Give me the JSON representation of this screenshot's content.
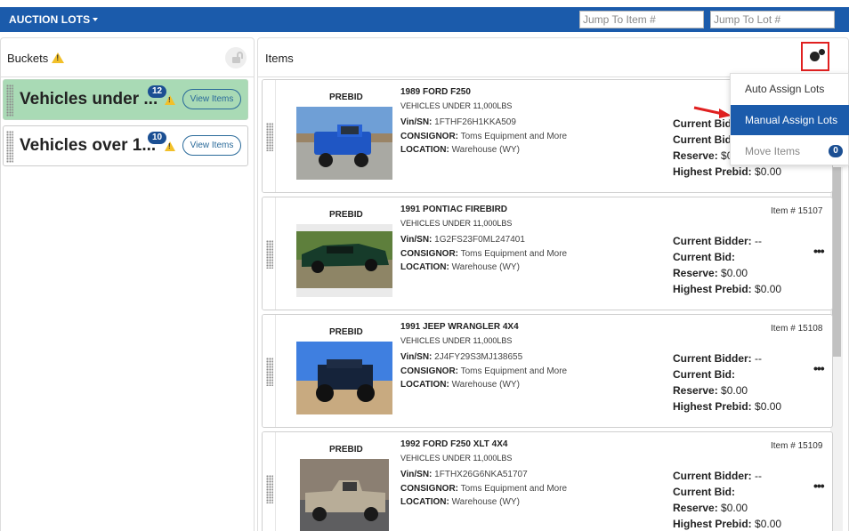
{
  "topbar": {
    "title": "AUCTION LOTS",
    "jump_item_placeholder": "Jump To Item #",
    "jump_lot_placeholder": "Jump To Lot #"
  },
  "buckets": {
    "title": "Buckets",
    "items": [
      {
        "name": "Vehicles under ...",
        "count": "12",
        "button": "View Items",
        "active": true
      },
      {
        "name": "Vehicles over 1...",
        "count": "10",
        "button": "View Items",
        "active": false
      }
    ]
  },
  "items_panel": {
    "title": "Items",
    "items": [
      {
        "tag": "PREBID",
        "title": "1989 FORD F250",
        "category": "VEHICLES UNDER 11,000LBS",
        "vin_label": "Vin/SN:",
        "vin": "1FTHF26H1KKA509",
        "consignor_label": "CONSIGNOR:",
        "consignor": "Toms Equipment and More",
        "location_label": "LOCATION:",
        "location": "Warehouse (WY)",
        "item_no": "",
        "current_bidder_label": "Current Bid",
        "current_bidder": "",
        "current_bid_label": "Current Bid",
        "current_bid": "",
        "reserve_label": "Reserve:",
        "reserve": "$0.",
        "highest_prebid_label": "Highest Prebid:",
        "highest_prebid": "$0.00"
      },
      {
        "tag": "PREBID",
        "title": "1991 PONTIAC FIREBIRD",
        "category": "VEHICLES UNDER 11,000LBS",
        "vin_label": "Vin/SN:",
        "vin": "1G2FS23F0ML247401",
        "consignor_label": "CONSIGNOR:",
        "consignor": "Toms Equipment and More",
        "location_label": "LOCATION:",
        "location": "Warehouse (WY)",
        "item_no": "Item # 15107",
        "current_bidder_label": "Current Bidder:",
        "current_bidder": "--",
        "current_bid_label": "Current Bid:",
        "current_bid": "",
        "reserve_label": "Reserve:",
        "reserve": "$0.00",
        "highest_prebid_label": "Highest Prebid:",
        "highest_prebid": "$0.00"
      },
      {
        "tag": "PREBID",
        "title": "1991 JEEP WRANGLER 4X4",
        "category": "VEHICLES UNDER 11,000LBS",
        "vin_label": "Vin/SN:",
        "vin": "2J4FY29S3MJ138655",
        "consignor_label": "CONSIGNOR:",
        "consignor": "Toms Equipment and More",
        "location_label": "LOCATION:",
        "location": "Warehouse (WY)",
        "item_no": "Item # 15108",
        "current_bidder_label": "Current Bidder:",
        "current_bidder": "--",
        "current_bid_label": "Current Bid:",
        "current_bid": "",
        "reserve_label": "Reserve:",
        "reserve": "$0.00",
        "highest_prebid_label": "Highest Prebid:",
        "highest_prebid": "$0.00"
      },
      {
        "tag": "PREBID",
        "title": "1992 FORD F250 XLT 4X4",
        "category": "VEHICLES UNDER 11,000LBS",
        "vin_label": "Vin/SN:",
        "vin": "1FTHX26G6NKA51707",
        "consignor_label": "CONSIGNOR:",
        "consignor": "Toms Equipment and More",
        "location_label": "LOCATION:",
        "location": "Warehouse (WY)",
        "item_no": "Item # 15109",
        "current_bidder_label": "Current Bidder:",
        "current_bidder": "--",
        "current_bid_label": "Current Bid:",
        "current_bid": "",
        "reserve_label": "Reserve:",
        "reserve": "$0.00",
        "highest_prebid_label": "Highest Prebid:",
        "highest_prebid": "$0.00"
      }
    ]
  },
  "dropdown": {
    "items": [
      {
        "label": "Auto Assign Lots",
        "state": "normal"
      },
      {
        "label": "Manual Assign Lots",
        "state": "selected"
      },
      {
        "label": "Move Items",
        "state": "disabled",
        "badge": "0"
      }
    ]
  },
  "icons": {
    "settings": "gears-icon",
    "lock": "unlock-icon",
    "warning": "warning-icon",
    "more": "ellipsis-icon",
    "grip": "drag-handle-icon",
    "arrow": "red-arrow-icon"
  },
  "colors": {
    "brand_blue": "#1b5bab",
    "badge_blue": "#1b4f93",
    "active_bucket": "#a9dab5",
    "warning": "#f2c029",
    "highlight_red": "#e02020"
  }
}
